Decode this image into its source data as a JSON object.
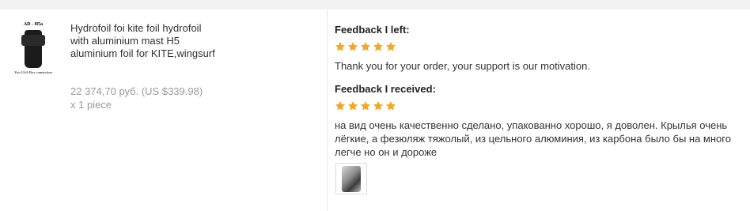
{
  "product": {
    "thumb_logo": "AD - H5a",
    "thumb_caption": "You USA Box connection",
    "title": "Hydrofoil foi kite foil hydrofoil with aluminium mast H5 aluminium foil for KITE,wingsurf",
    "price": "22 374,70 руб. (US $339.98) x 1 piece"
  },
  "feedback_left": {
    "heading": "Feedback I left:",
    "rating": 5,
    "text": "Thank you for your order, your support is our motivation."
  },
  "feedback_received": {
    "heading": "Feedback I received:",
    "rating": 5,
    "text": "на вид очень качественно сделано, упакованно хорошо, я доволен. Крылья очень лёгкие, а фезюляж тяжолый, из цельного алюминия, из карбона было бы на много легче но он и дороже"
  },
  "colors": {
    "star": "#f5a623",
    "price": "#999999"
  }
}
